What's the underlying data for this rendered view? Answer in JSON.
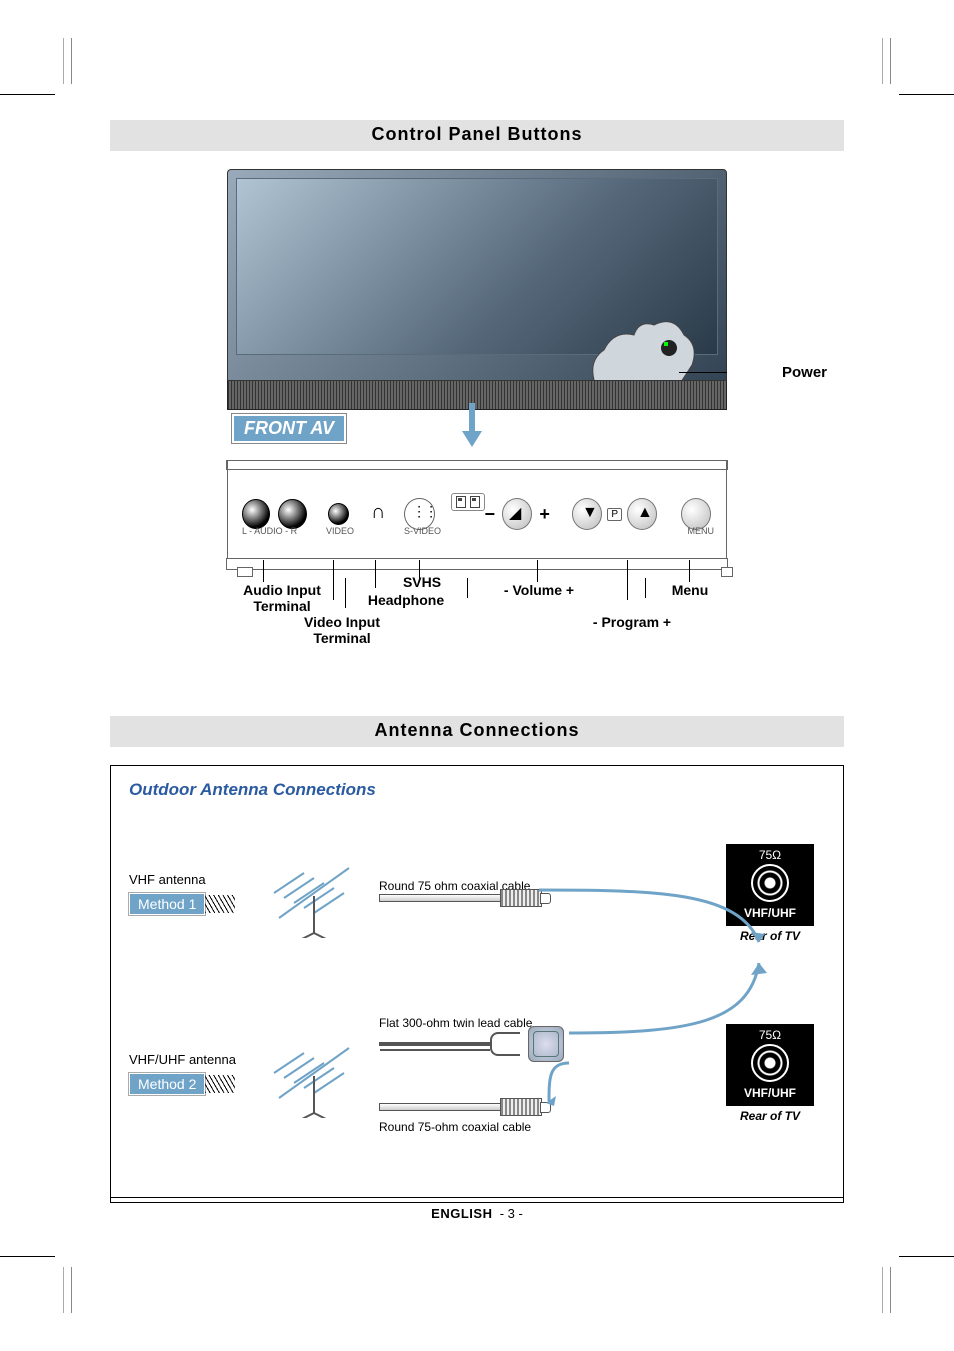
{
  "section1_title": "Control  Panel  Buttons",
  "front_av_badge": "FRONT AV",
  "panel": {
    "power": "Power",
    "audio_label_tiny": "L  -  AUDIO  -  R",
    "video_label_tiny": "VIDEO",
    "svideo_label_tiny": "S-VIDEO",
    "menu_label_tiny": "MENU",
    "p_label_tiny": "P",
    "callouts": {
      "audio": "Audio Input\nTerminal",
      "video": "Video Input\nTerminal",
      "headphone": "Headphone",
      "svhs": "SVHS",
      "volume": "- Volume +",
      "program": "- Program +",
      "menu": "Menu"
    }
  },
  "section2_title": "Antenna  Connections",
  "antenna": {
    "box_title": "Outdoor Antenna Connections",
    "method1": {
      "ant_label": "VHF antenna",
      "badge": "Method 1",
      "cable_label": "Round 75 ohm coaxial cable"
    },
    "method2": {
      "ant_label": "VHF/UHF antenna",
      "badge": "Method 2",
      "twin_label": "Flat 300-ohm twin lead cable",
      "coax_label": "Round 75-ohm coaxial cable"
    },
    "rear": {
      "ohm": "75Ω",
      "vhf": "VHF/UHF",
      "caption": "Rear of TV"
    }
  },
  "footer": {
    "lang": "ENGLISH",
    "page": "- 3 -"
  }
}
